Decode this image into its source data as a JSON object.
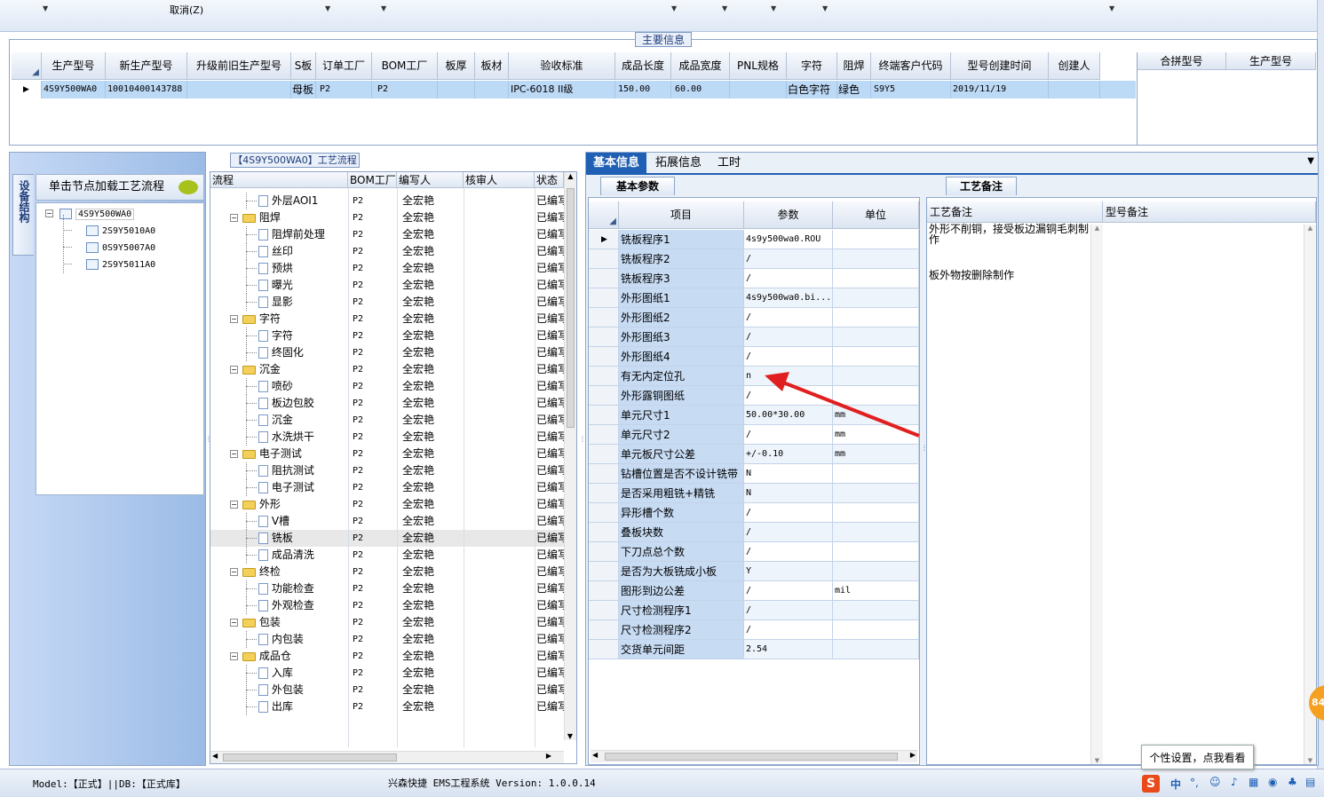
{
  "toolbar": {
    "cancel": "取消(Z)"
  },
  "main_info": {
    "caption": "主要信息",
    "columns": [
      "生产型号",
      "新生产型号",
      "升级前旧生产型号",
      "S板",
      "订单工厂",
      "BOM工厂",
      "板厚",
      "板材",
      "验收标准",
      "成品长度",
      "成品宽度",
      "PNL规格",
      "字符",
      "阻焊",
      "终端客户代码",
      "型号创建时间",
      "创建人"
    ],
    "row": {
      "prod_no": "4S9Y500WA0",
      "new_no": "10010400143788",
      "sboard": "母板",
      "order_factory": "P2",
      "bom_factory": "P2",
      "standard": "IPC-6018 II级",
      "length": "150.00",
      "width": "60.00",
      "char": "白色字符",
      "solder": "绿色",
      "customer": "S9Y5",
      "created": "2019/11/19"
    },
    "merge_columns": [
      "合拼型号",
      "生产型号"
    ]
  },
  "left": {
    "vtab": "设备结构",
    "load_label": "单击节点加载工艺流程",
    "tree": [
      "4S9Y500WA0",
      "2S9Y5010A0",
      "0S9Y5007A0",
      "2S9Y5011A0"
    ]
  },
  "process": {
    "caption": "【4S9Y500WA0】工艺流程",
    "columns": [
      "流程",
      "BOM工厂",
      "编写人",
      "核审人",
      "状态"
    ],
    "rows": [
      {
        "name": "外层AOI1",
        "level": 1,
        "factory": "P2",
        "writer": "全宏艳",
        "status": "已编写"
      },
      {
        "name": "阻焊",
        "level": 0,
        "factory": "P2",
        "writer": "全宏艳",
        "status": "已编写"
      },
      {
        "name": "阻焊前处理",
        "level": 1,
        "factory": "P2",
        "writer": "全宏艳",
        "status": "已编写"
      },
      {
        "name": "丝印",
        "level": 1,
        "factory": "P2",
        "writer": "全宏艳",
        "status": "已编写"
      },
      {
        "name": "预烘",
        "level": 1,
        "factory": "P2",
        "writer": "全宏艳",
        "status": "已编写"
      },
      {
        "name": "曝光",
        "level": 1,
        "factory": "P2",
        "writer": "全宏艳",
        "status": "已编写"
      },
      {
        "name": "显影",
        "level": 1,
        "factory": "P2",
        "writer": "全宏艳",
        "status": "已编写"
      },
      {
        "name": "字符",
        "level": 0,
        "factory": "P2",
        "writer": "全宏艳",
        "status": "已编写"
      },
      {
        "name": "字符",
        "level": 1,
        "factory": "P2",
        "writer": "全宏艳",
        "status": "已编写"
      },
      {
        "name": "终固化",
        "level": 1,
        "factory": "P2",
        "writer": "全宏艳",
        "status": "已编写"
      },
      {
        "name": "沉金",
        "level": 0,
        "factory": "P2",
        "writer": "全宏艳",
        "status": "已编写"
      },
      {
        "name": "喷砂",
        "level": 1,
        "factory": "P2",
        "writer": "全宏艳",
        "status": "已编写"
      },
      {
        "name": "板边包胶",
        "level": 1,
        "factory": "P2",
        "writer": "全宏艳",
        "status": "已编写"
      },
      {
        "name": "沉金",
        "level": 1,
        "factory": "P2",
        "writer": "全宏艳",
        "status": "已编写"
      },
      {
        "name": "水洗烘干",
        "level": 1,
        "factory": "P2",
        "writer": "全宏艳",
        "status": "已编写"
      },
      {
        "name": "电子测试",
        "level": 0,
        "factory": "P2",
        "writer": "全宏艳",
        "status": "已编写"
      },
      {
        "name": "阻抗测试",
        "level": 1,
        "factory": "P2",
        "writer": "全宏艳",
        "status": "已编写"
      },
      {
        "name": "电子测试",
        "level": 1,
        "factory": "P2",
        "writer": "全宏艳",
        "status": "已编写"
      },
      {
        "name": "外形",
        "level": 0,
        "factory": "P2",
        "writer": "全宏艳",
        "status": "已编写"
      },
      {
        "name": "V槽",
        "level": 1,
        "factory": "P2",
        "writer": "全宏艳",
        "status": "已编写"
      },
      {
        "name": "铣板",
        "level": 1,
        "factory": "P2",
        "writer": "全宏艳",
        "status": "已编写"
      },
      {
        "name": "成品清洗",
        "level": 1,
        "factory": "P2",
        "writer": "全宏艳",
        "status": "已编写"
      },
      {
        "name": "终检",
        "level": 0,
        "factory": "P2",
        "writer": "全宏艳",
        "status": "已编写"
      },
      {
        "name": "功能检查",
        "level": 1,
        "factory": "P2",
        "writer": "全宏艳",
        "status": "已编写"
      },
      {
        "name": "外观检查",
        "level": 1,
        "factory": "P2",
        "writer": "全宏艳",
        "status": "已编写"
      },
      {
        "name": "包装",
        "level": 0,
        "factory": "P2",
        "writer": "全宏艳",
        "status": "已编写"
      },
      {
        "name": "内包装",
        "level": 1,
        "factory": "P2",
        "writer": "全宏艳",
        "status": "已编写"
      },
      {
        "name": "成品仓",
        "level": 0,
        "factory": "P2",
        "writer": "全宏艳",
        "status": "已编写"
      },
      {
        "name": "入库",
        "level": 1,
        "factory": "P2",
        "writer": "全宏艳",
        "status": "已编写"
      },
      {
        "name": "外包装",
        "level": 1,
        "factory": "P2",
        "writer": "全宏艳",
        "status": "已编写"
      },
      {
        "name": "出库",
        "level": 1,
        "factory": "P2",
        "writer": "全宏艳",
        "status": "已编写"
      }
    ]
  },
  "tabs": [
    "基本信息",
    "拓展信息",
    "工时"
  ],
  "basic": {
    "caption": "基本参数",
    "columns": [
      "项目",
      "参数",
      "单位"
    ],
    "rows": [
      {
        "item": "铣板程序1",
        "param": "4s9y500wa0.ROU",
        "unit": ""
      },
      {
        "item": "铣板程序2",
        "param": "/",
        "unit": ""
      },
      {
        "item": "铣板程序3",
        "param": "/",
        "unit": ""
      },
      {
        "item": "外形图纸1",
        "param": "4s9y500wa0.bi...",
        "unit": ""
      },
      {
        "item": "外形图纸2",
        "param": "/",
        "unit": ""
      },
      {
        "item": "外形图纸3",
        "param": "/",
        "unit": ""
      },
      {
        "item": "外形图纸4",
        "param": "/",
        "unit": ""
      },
      {
        "item": "有无内定位孔",
        "param": "n",
        "unit": ""
      },
      {
        "item": "外形露铜图纸",
        "param": "/",
        "unit": ""
      },
      {
        "item": "单元尺寸1",
        "param": "50.00*30.00",
        "unit": "mm"
      },
      {
        "item": "单元尺寸2",
        "param": "/",
        "unit": "mm"
      },
      {
        "item": "单元板尺寸公差",
        "param": "+/-0.10",
        "unit": "mm"
      },
      {
        "item": "钻槽位置是否不设计铣带",
        "param": "N",
        "unit": ""
      },
      {
        "item": "是否采用粗铣+精铣",
        "param": "N",
        "unit": ""
      },
      {
        "item": "异形槽个数",
        "param": "/",
        "unit": ""
      },
      {
        "item": "叠板块数",
        "param": "/",
        "unit": ""
      },
      {
        "item": "下刀点总个数",
        "param": "/",
        "unit": ""
      },
      {
        "item": "是否为大板铣成小板",
        "param": "Y",
        "unit": ""
      },
      {
        "item": "图形到边公差",
        "param": "/",
        "unit": "mil"
      },
      {
        "item": "尺寸检测程序1",
        "param": "/",
        "unit": ""
      },
      {
        "item": "尺寸检测程序2",
        "param": "/",
        "unit": ""
      },
      {
        "item": "交货单元间距",
        "param": "2.54",
        "unit": ""
      }
    ]
  },
  "notes": {
    "caption": "工艺备注",
    "col1": "工艺备注",
    "col2": "型号备注",
    "text1": "外形不削铜，接受板边漏铜毛刺制作",
    "text2": "板外物按删除制作"
  },
  "status": {
    "model": "Model:【正式】||DB:【正式库】",
    "system": "兴森快捷 EMS工程系统 Version: 1.0.0.14",
    "tooltip": "个性设置，点我看看",
    "badge": "84",
    "ime": "中"
  },
  "colors": {
    "accent": "#1f5fb4",
    "selected_row": "#bcd9f6",
    "arrow": "#e02020"
  }
}
